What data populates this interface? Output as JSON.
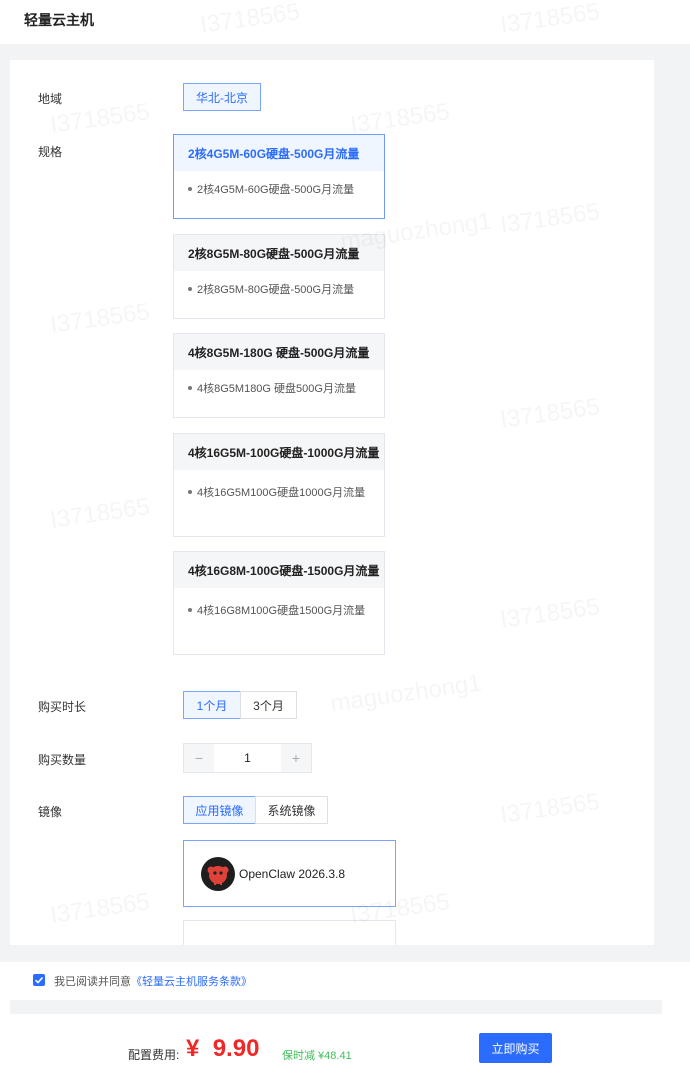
{
  "header": {
    "title": "轻量云主机"
  },
  "labels": {
    "region": "地域",
    "spec": "规格",
    "duration": "购买时长",
    "quantity": "购买数量",
    "image": "镜像"
  },
  "region": {
    "selected": "华北-北京"
  },
  "specs": [
    {
      "title": "2核4G5M-60G硬盘-500G月流量",
      "desc": "2核4G5M-60G硬盘-500G月流量",
      "selected": true
    },
    {
      "title": "2核8G5M-80G硬盘-500G月流量",
      "desc": "2核8G5M-80G硬盘-500G月流量",
      "selected": false
    },
    {
      "title": "4核8G5M-180G 硬盘-500G月流量",
      "desc": "4核8G5M180G 硬盘500G月流量",
      "selected": false
    },
    {
      "title": "4核16G5M-100G硬盘-1000G月流量",
      "desc": "4核16G5M100G硬盘1000G月流量",
      "selected": false
    },
    {
      "title": "4核16G8M-100G硬盘-1500G月流量",
      "desc": "4核16G8M100G硬盘1500G月流量",
      "selected": false
    }
  ],
  "duration": {
    "options": [
      "1个月",
      "3个月"
    ],
    "selected": "1个月"
  },
  "quantity": {
    "value": "1",
    "minus": "−",
    "plus": "+"
  },
  "image": {
    "tabs": [
      "应用镜像",
      "系统镜像"
    ],
    "selected_tab": "应用镜像",
    "items": [
      {
        "name": "OpenClaw 2026.3.8",
        "icon": "openclaw-logo-icon"
      }
    ]
  },
  "agreement": {
    "prefix": "我已阅读并同意",
    "link": "《轻量云主机服务条款》",
    "checked": true
  },
  "footer": {
    "fee_label": "配置费用:",
    "currency": "¥",
    "fee": "9.90",
    "save_text": "保时减 ¥48.41",
    "buy_label": "立即购买"
  },
  "watermark": {
    "texts": [
      "I3718565",
      "maguozhong1"
    ]
  },
  "colors": {
    "accent": "#2b6cff",
    "price": "#f02828",
    "save": "#3fbf5a"
  }
}
